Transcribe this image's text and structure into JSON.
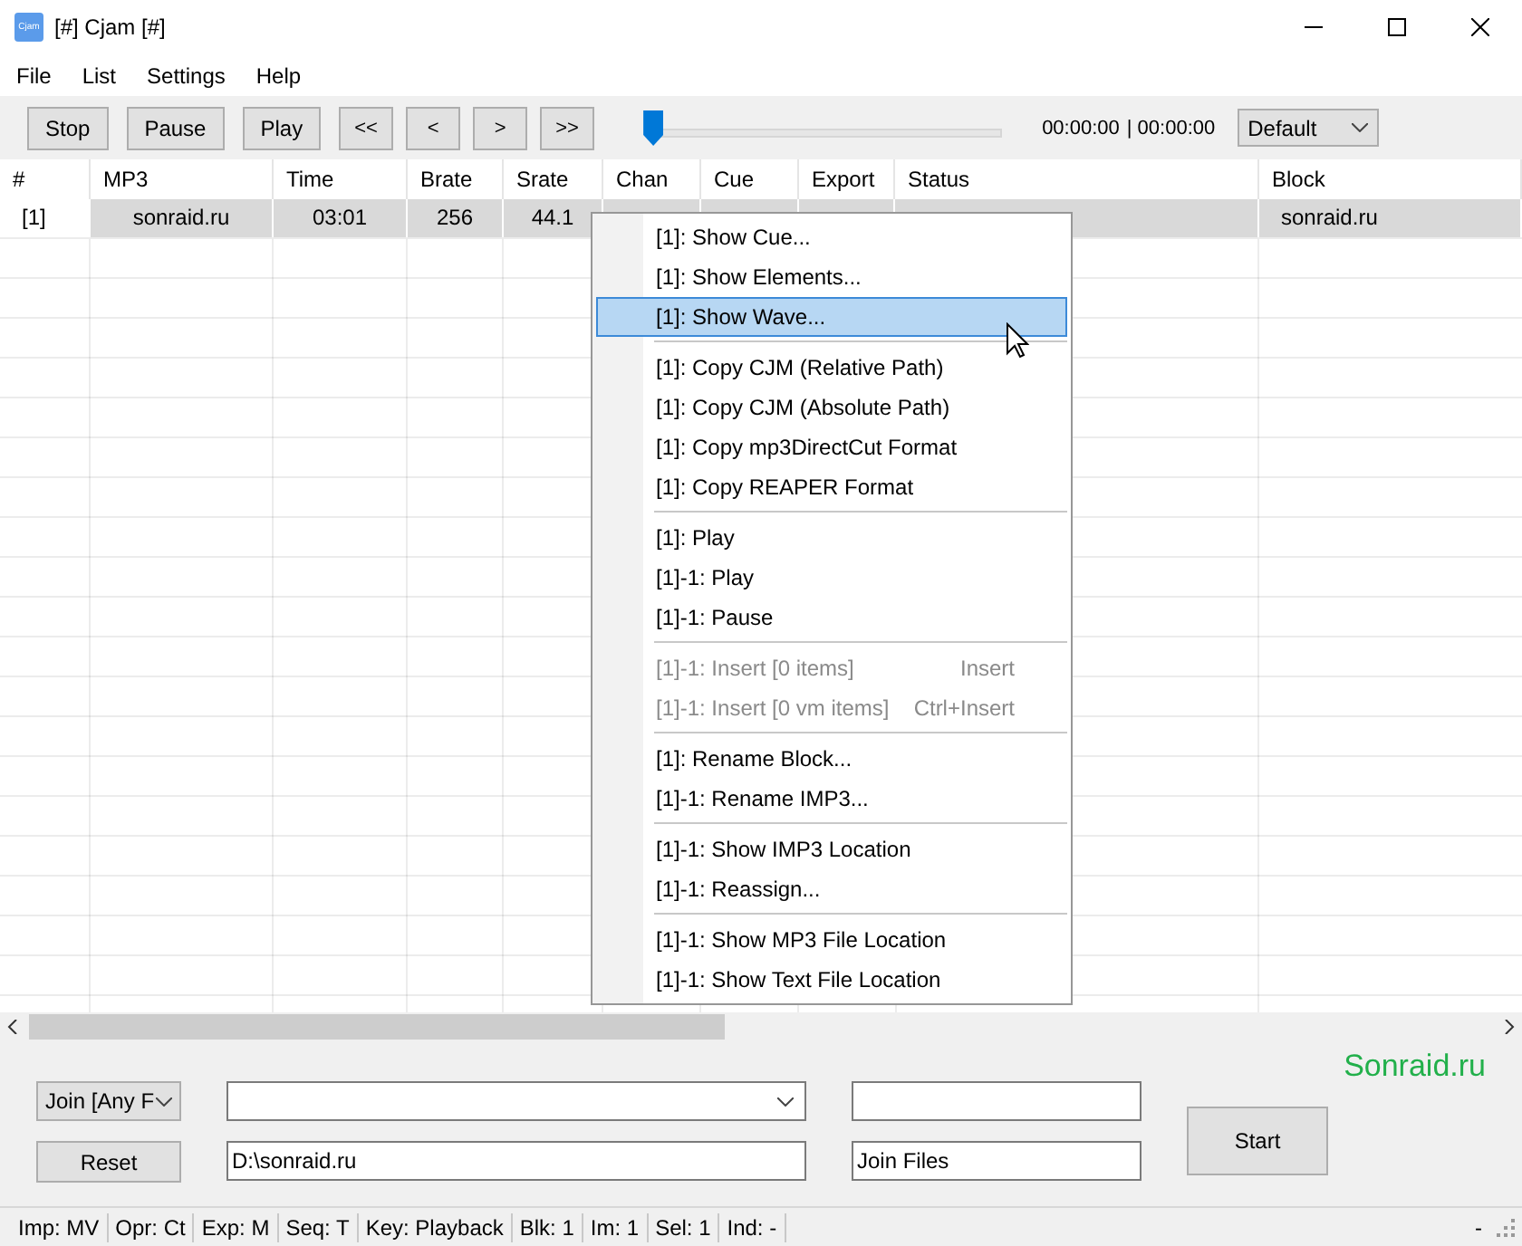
{
  "window": {
    "title": "[#] Cjam [#]",
    "icon_text": "Cjam"
  },
  "menu_bar": [
    "File",
    "List",
    "Settings",
    "Help"
  ],
  "toolbar": {
    "buttons": [
      "Stop",
      "Pause",
      "Play",
      "<<",
      "<",
      ">",
      ">>"
    ],
    "position": {
      "level": 0
    },
    "time": "00:00:00",
    "duration": "| 00:00:00",
    "preset": "Default"
  },
  "table": {
    "columns": [
      "#",
      "MP3",
      "Time",
      "Brate",
      "Srate",
      "Chan",
      "Cue",
      "Export",
      "Status",
      "Block"
    ],
    "rows": [
      {
        "selected": true,
        "cells": [
          "[1]",
          "sonraid.ru",
          "03:01",
          "256",
          "44.1",
          "",
          "",
          "",
          "",
          "sonraid.ru"
        ]
      }
    ]
  },
  "context_menu": {
    "groups": [
      [
        {
          "label": "[1]: Show Cue...",
          "selected": false,
          "disabled": false
        },
        {
          "label": "[1]: Show Elements...",
          "selected": false,
          "disabled": false
        },
        {
          "label": "[1]: Show Wave...",
          "selected": true,
          "disabled": false
        }
      ],
      [
        {
          "label": "[1]: Copy CJM (Relative Path)",
          "selected": false,
          "disabled": false
        },
        {
          "label": "[1]: Copy CJM (Absolute Path)",
          "selected": false,
          "disabled": false
        },
        {
          "label": "[1]: Copy mp3DirectCut Format",
          "selected": false,
          "disabled": false
        },
        {
          "label": "[1]: Copy REAPER Format",
          "selected": false,
          "disabled": false
        }
      ],
      [
        {
          "label": "[1]: Play",
          "selected": false,
          "disabled": false
        },
        {
          "label": "[1]-1: Play",
          "selected": false,
          "disabled": false
        },
        {
          "label": "[1]-1: Pause",
          "selected": false,
          "disabled": false
        }
      ],
      [
        {
          "label": "[1]-1: Insert [0 items]",
          "shortcut": "Insert",
          "selected": false,
          "disabled": true
        },
        {
          "label": "[1]-1: Insert [0 vm items]",
          "shortcut": "Ctrl+Insert",
          "selected": false,
          "disabled": true
        }
      ],
      [
        {
          "label": "[1]: Rename Block...",
          "selected": false,
          "disabled": false
        },
        {
          "label": "[1]-1: Rename IMP3...",
          "selected": false,
          "disabled": false
        }
      ],
      [
        {
          "label": "[1]-1: Show IMP3 Location",
          "selected": false,
          "disabled": false
        },
        {
          "label": "[1]-1: Reassign...",
          "selected": false,
          "disabled": false
        }
      ],
      [
        {
          "label": "[1]-1: Show MP3 File Location",
          "selected": false,
          "disabled": false
        },
        {
          "label": "[1]-1: Show Text File Location",
          "selected": false,
          "disabled": false
        }
      ]
    ]
  },
  "bottom_panel": {
    "brand": "Sonraid.ru",
    "mode": "Join [Any F",
    "reset": "Reset",
    "folder": "D:\\sonraid.ru",
    "output_name": "Join Files",
    "start": "Start"
  },
  "status_bar": [
    "Imp: MV",
    "Opr: Ct",
    "Exp: M",
    "Seq: T",
    "Key: Playback",
    "Blk: 1",
    "Im: 1",
    "Sel: 1",
    "Ind: -",
    "-"
  ]
}
